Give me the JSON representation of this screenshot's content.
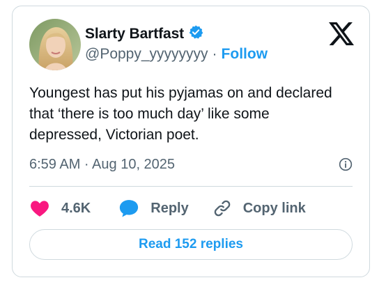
{
  "author": {
    "name": "Slarty Bartfast",
    "handle": "@Poppy_yyyyyyyy",
    "separator": "·",
    "follow_label": "Follow",
    "verified_color": "#1d9bf0"
  },
  "tweet": {
    "text": "Youngest has put his pyjamas on and declared that ‘there is too much day’ like some depressed, Victorian poet.",
    "timestamp": "6:59 AM · Aug 10, 2025"
  },
  "actions": {
    "like_count": "4.6K",
    "reply_label": "Reply",
    "copy_link_label": "Copy link"
  },
  "replies_button": "Read 152 replies",
  "icons": {
    "logo": "x-logo-icon",
    "verified": "verified-badge-icon",
    "info": "info-icon",
    "like": "heart-icon",
    "reply": "speech-bubble-icon",
    "copy": "link-icon"
  },
  "colors": {
    "accent": "#1d9bf0",
    "like": "#f91880",
    "secondary_text": "#536471",
    "border": "#cfd9de"
  }
}
